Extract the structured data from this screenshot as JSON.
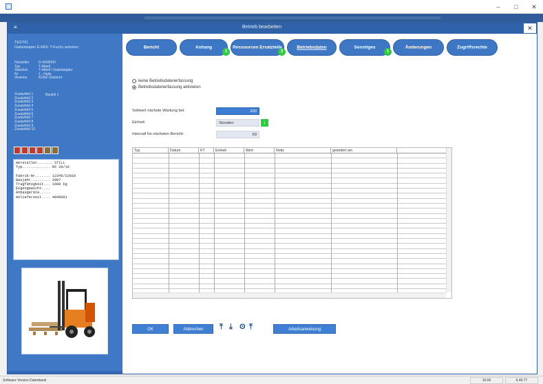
{
  "window": {
    "title": "Betrieb bearbeiten",
    "minimize": "–",
    "maximize": "□",
    "close": "✕"
  },
  "dialog": {
    "title": "Betrieb bearbeiten",
    "close": "✕",
    "menu": "≡"
  },
  "sidebar": {
    "header_line1": "TEST01",
    "header_line2": "Gabelstapler E-MOL T-Fuchs antreten",
    "fields": [
      {
        "k": "Hersteller",
        "v": "D-4000000"
      },
      {
        "k": "Typ",
        "v": "T-Abtell"
      },
      {
        "k": "Standort",
        "v": "T-Abtell / Gabelstapler"
      },
      {
        "k": "Nr",
        "v": "1 - Halle"
      },
      {
        "k": "Verantw.",
        "v": "KUNZ-Standort"
      }
    ],
    "custom_fields": [
      "Zusatzfeld 1",
      "Zusatzfeld 2",
      "Zusatzfeld 3",
      "Zusatzfeld 4",
      "Zusatzfeld 5",
      "Zusatzfeld 6",
      "Zusatzfeld 7",
      "Zusatzfeld 8",
      "Zusatzfeld 9",
      "Zusatzfeld 10"
    ],
    "custom_value": "Bauteil 1",
    "info_text": "Hersteller....... STILL\nTyp............. RX 20/16\n\nFabrik-Nr....... 12345/22010\nBaujahr......... 2007\nTragfähigkeit... 1600 kg\nEigengewicht....\nAnbaugeräte.....\nAnlieferzeit.... 4045001"
  },
  "tabs": [
    {
      "label": "Bericht",
      "badge": ""
    },
    {
      "label": "Anhang",
      "badge": "1"
    },
    {
      "label": "Ressourcen Ersatzteile",
      "badge": "2"
    },
    {
      "label": "Betriebsdaten",
      "badge": ""
    },
    {
      "label": "Sonstiges",
      "badge": "1"
    },
    {
      "label": "Änderungen",
      "badge": ""
    },
    {
      "label": "Zugriffsrechte",
      "badge": ""
    }
  ],
  "radios": {
    "none": "keine Betriebsdatenerfassung",
    "active": "Betriebsdatenerfassung aktivieren"
  },
  "form": {
    "target_label": "Sollwert nächste Wartung bei:",
    "target_value": "200",
    "unit_label": "Einheit:",
    "unit_value": "Stunden",
    "unit_button": "↓",
    "interval_label": "Intervall für nächsten Bericht:",
    "interval_value": "50"
  },
  "table": {
    "columns": [
      "Typ",
      "Datum",
      "KT",
      "Einheit",
      "Wert",
      "Notiz",
      "geändert am"
    ]
  },
  "buttons": {
    "ok": "OK",
    "cancel": "Abbrechen",
    "upload": "⤒",
    "download": "⤓",
    "attach": "ʘ",
    "export": "⤒",
    "guide": "Arbeitsanweisung"
  },
  "status": {
    "left": "Software Version Datenbank",
    "right1": "16:06",
    "right2": "6.40.77"
  }
}
